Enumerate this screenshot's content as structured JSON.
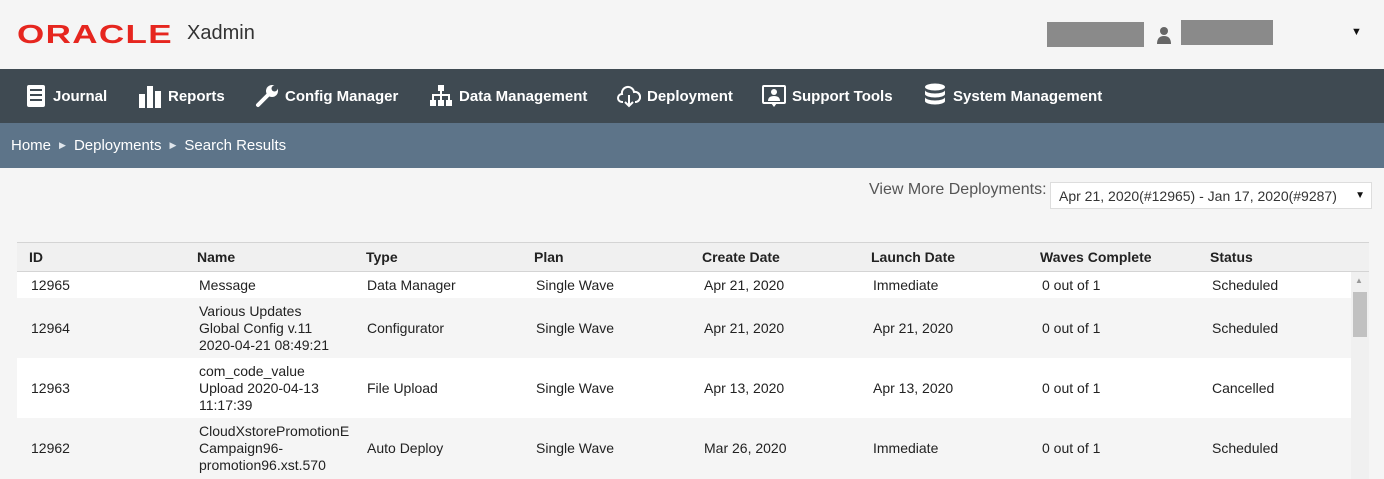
{
  "header": {
    "logo_text": "ORACLE",
    "product": "Xadmin",
    "brand_color": "#e6261f",
    "user_icon": "user-icon"
  },
  "nav": [
    {
      "label": "Journal",
      "icon": "journal-icon"
    },
    {
      "label": "Reports",
      "icon": "bar-chart-icon"
    },
    {
      "label": "Config Manager",
      "icon": "wrench-icon"
    },
    {
      "label": "Data Management",
      "icon": "hierarchy-icon"
    },
    {
      "label": "Deployment",
      "icon": "cloud-download-icon"
    },
    {
      "label": "Support Tools",
      "icon": "support-icon"
    },
    {
      "label": "System Management",
      "icon": "database-icon"
    }
  ],
  "breadcrumb": [
    "Home",
    "Deployments",
    "Search Results"
  ],
  "view_more": {
    "label": "View More Deployments:",
    "selected": "Apr 21, 2020(#12965) - Jan 17, 2020(#9287)"
  },
  "table": {
    "columns": [
      "ID",
      "Name",
      "Type",
      "Plan",
      "Create Date",
      "Launch Date",
      "Waves Complete",
      "Status"
    ],
    "rows": [
      {
        "id": "12965",
        "name": [
          "Message"
        ],
        "type": "Data Manager",
        "plan": "Single Wave",
        "create": "Apr 21, 2020",
        "launch": "Immediate",
        "waves": "0 out of 1",
        "status": "Scheduled"
      },
      {
        "id": "12964",
        "name": [
          "Various Updates",
          "Global Config v.11",
          "2020-04-21 08:49:21"
        ],
        "type": "Configurator",
        "plan": "Single Wave",
        "create": "Apr 21, 2020",
        "launch": "Apr 21, 2020",
        "waves": "0 out of 1",
        "status": "Scheduled"
      },
      {
        "id": "12963",
        "name": [
          "com_code_value",
          "Upload 2020-04-13",
          "11:17:39"
        ],
        "type": "File Upload",
        "plan": "Single Wave",
        "create": "Apr 13, 2020",
        "launch": "Apr 13, 2020",
        "waves": "0 out of 1",
        "status": "Cancelled"
      },
      {
        "id": "12962",
        "name": [
          "CloudXstorePromotionE",
          "Campaign96-",
          "promotion96.xst.570"
        ],
        "type": "Auto Deploy",
        "plan": "Single Wave",
        "create": "Mar 26, 2020",
        "launch": "Immediate",
        "waves": "0 out of 1",
        "status": "Scheduled"
      }
    ]
  }
}
